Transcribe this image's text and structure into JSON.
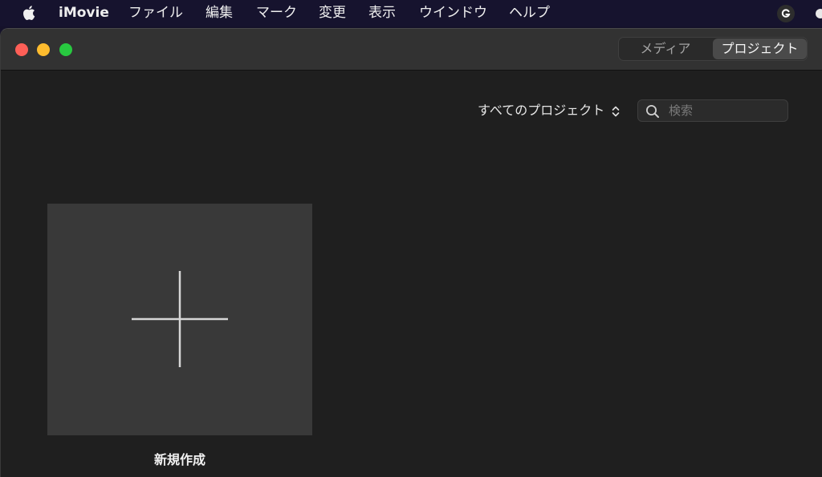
{
  "menubar": {
    "apple_icon": "apple-logo-icon",
    "app_name": "iMovie",
    "items": [
      "ファイル",
      "編集",
      "マーク",
      "変更",
      "表示",
      "ウインドウ",
      "ヘルプ"
    ],
    "status_icons": [
      "grammarly-icon",
      "status-dot-icon"
    ]
  },
  "window": {
    "traffic_lights": {
      "close": "#fe5f57",
      "minimize": "#febc2e",
      "maximize": "#28c840"
    },
    "tabs": {
      "media": "メディア",
      "projects": "プロジェクト",
      "selected": "projects"
    },
    "filter": {
      "label": "すべてのプロジェクト",
      "icon": "up-down-chevron-icon"
    },
    "search": {
      "placeholder": "検索",
      "value": "",
      "icon": "search-icon"
    },
    "new_project": {
      "label": "新規作成",
      "icon": "plus-icon"
    }
  },
  "colors": {
    "menubar_bg": "#16132e",
    "window_bg": "#1f1f1f",
    "titlebar_bg": "#323232",
    "tile_bg": "#393939"
  }
}
